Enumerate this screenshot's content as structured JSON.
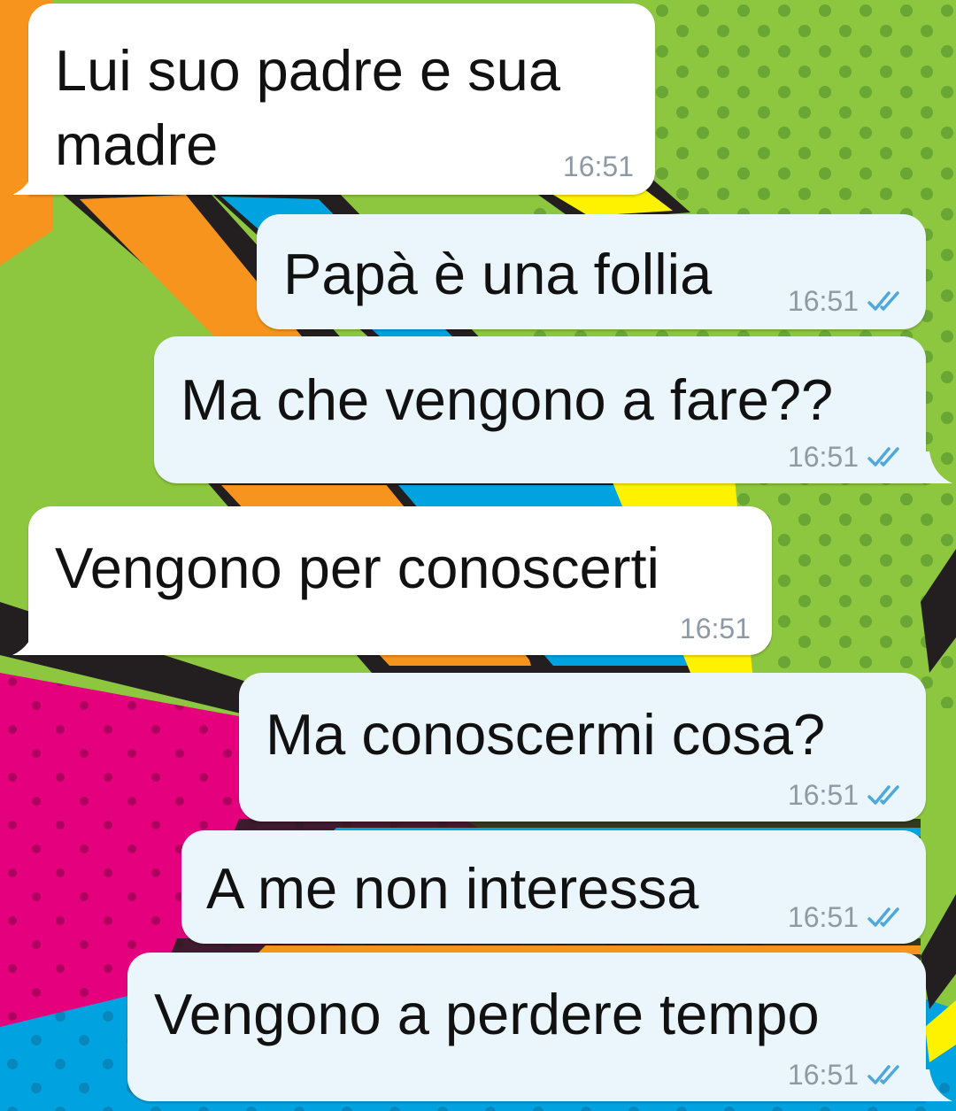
{
  "conversation": {
    "messages": [
      {
        "direction": "incoming",
        "text": "Lui suo padre e sua\nmadre",
        "time": "16:51"
      },
      {
        "direction": "outgoing",
        "text": "Papà è una follia",
        "time": "16:51",
        "status_icon": "double-check-icon"
      },
      {
        "direction": "outgoing",
        "text": "Ma che vengono a fare??",
        "time": "16:51",
        "status_icon": "double-check-icon"
      },
      {
        "direction": "incoming",
        "text": "Vengono per conoscerti",
        "time": "16:51"
      },
      {
        "direction": "outgoing",
        "text": "Ma conoscermi cosa?",
        "time": "16:51",
        "status_icon": "double-check-icon"
      },
      {
        "direction": "outgoing",
        "text": "A me non interessa",
        "time": "16:51",
        "status_icon": "double-check-icon"
      },
      {
        "direction": "outgoing",
        "text": "Vengono a perdere tempo",
        "time": "16:51",
        "status_icon": "double-check-icon"
      }
    ]
  },
  "theme": {
    "incoming_bubble": "#ffffff",
    "outgoing_bubble": "#eaf6fb",
    "text_color": "#111111",
    "time_color": "#8e9aa3",
    "read_tick_color": "#4fa8dc",
    "wallpaper_colors": [
      "#8dc63f",
      "#e5007e",
      "#00a3e0",
      "#f7941d",
      "#fff200",
      "#231f20"
    ]
  }
}
